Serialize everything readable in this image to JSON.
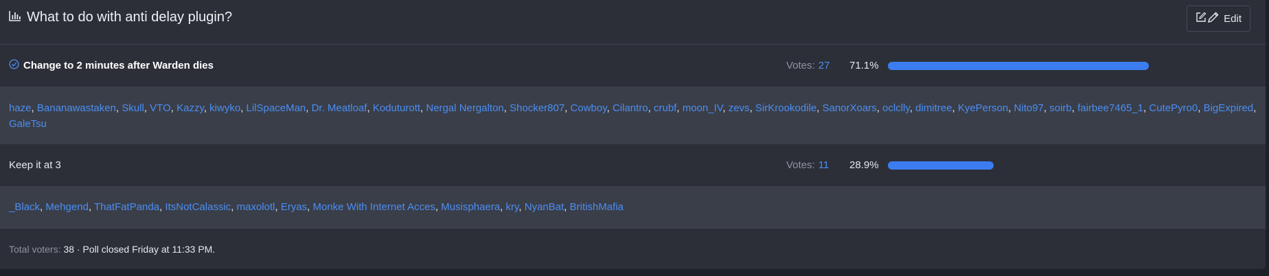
{
  "poll": {
    "title": "What to do with anti delay plugin?",
    "edit_label": "Edit",
    "options": [
      {
        "label": "Change to 2 minutes after Warden dies",
        "selected": true,
        "votes_label": "Votes:",
        "votes": "27",
        "percent_text": "71.1%",
        "percent": 71.1,
        "voters": [
          "haze",
          "Bananawastaken",
          "Skull",
          "VTO",
          "Kazzy",
          "kiwyko",
          "LilSpaceMan",
          "Dr. Meatloaf",
          "Koduturott",
          "Nergal Nergalton",
          "Shocker807",
          "Cowboy",
          "Cilantro",
          "crubf",
          "moon_IV",
          "zevs",
          "SirKrookodile",
          "SanorXoars",
          "oclclly",
          "dimitree",
          "KyePerson",
          "Nito97",
          "soirb",
          "fairbee7465_1",
          "CutePyro0",
          "BigExpired",
          "GaleTsu"
        ]
      },
      {
        "label": "Keep it at 3",
        "selected": false,
        "votes_label": "Votes:",
        "votes": "11",
        "percent_text": "28.9%",
        "percent": 28.9,
        "voters": [
          "_Black",
          "Mehgend",
          "ThatFatPanda",
          "ItsNotCalassic",
          "maxolotl",
          "Eryas",
          "Monke With Internet Acces",
          "Musisphaera",
          "kry",
          "NyanBat",
          "BritishMafia"
        ]
      }
    ],
    "footer": {
      "total_label": "Total voters:",
      "total_text": "38 · Poll closed Friday at 11:33 PM."
    }
  },
  "colors": {
    "accent": "#3b7df0",
    "link": "#4b8ef2",
    "panel": "#2c2f38",
    "voters_bg": "#3a3e49"
  },
  "icons": {
    "title_icon": "bar-chart-icon",
    "selected_icon": "check-circle-icon",
    "edit_icons": [
      "edit-square-icon",
      "pencil-icon"
    ]
  }
}
